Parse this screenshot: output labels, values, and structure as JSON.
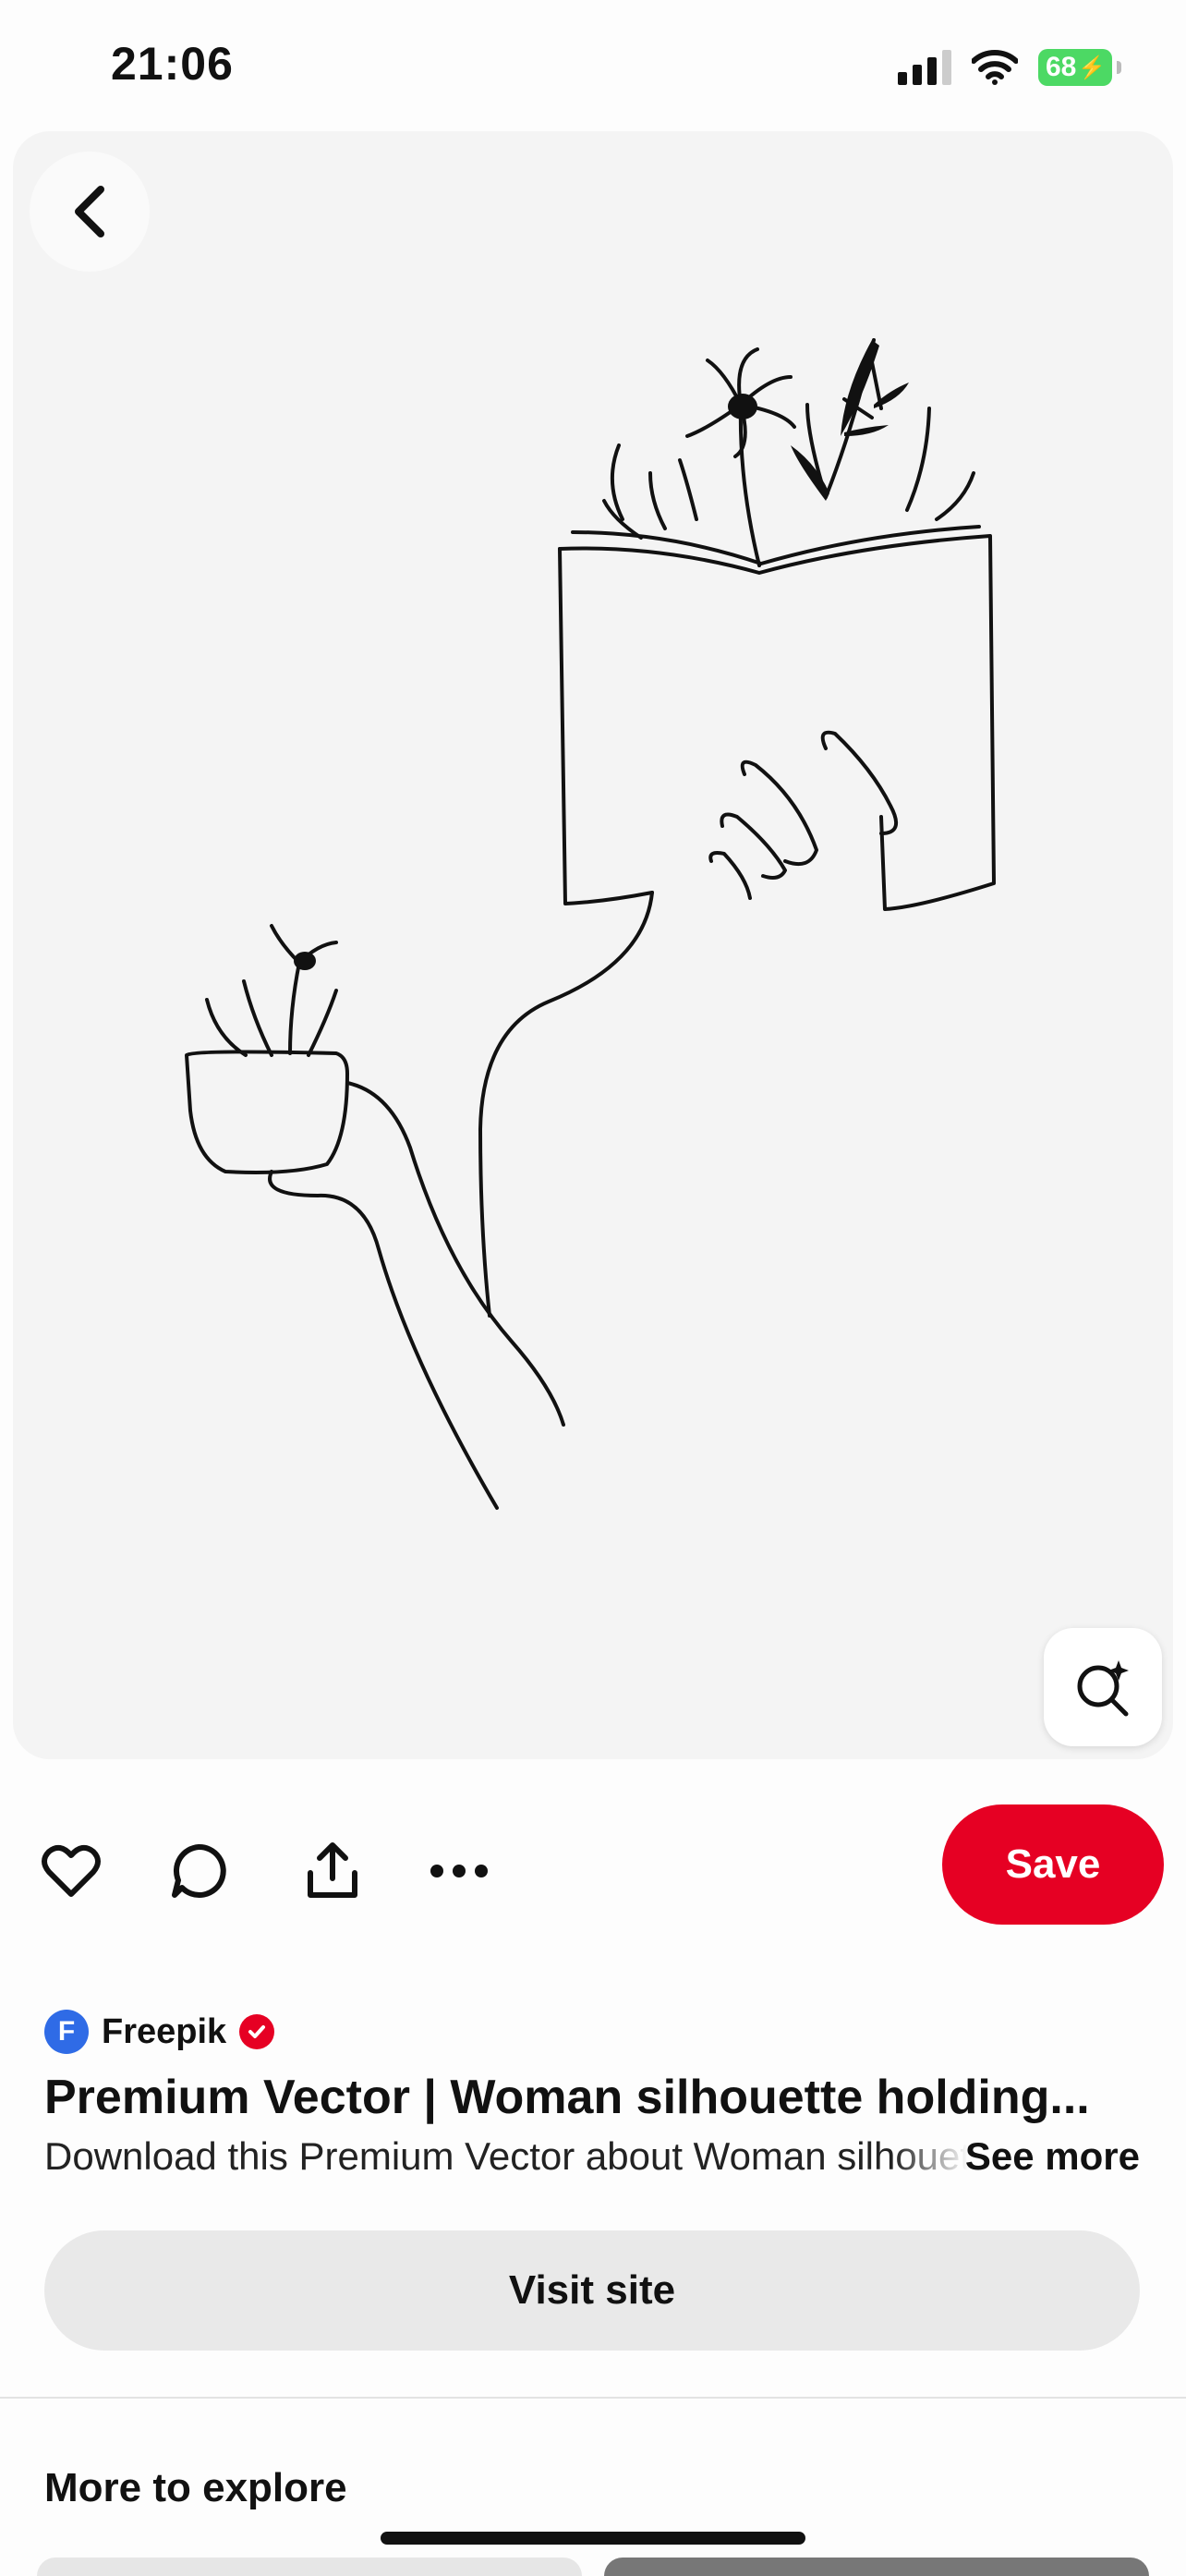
{
  "status_bar": {
    "time": "21:06",
    "battery": "68",
    "icons": [
      "signal-icon",
      "wifi-icon",
      "battery-charging-icon"
    ]
  },
  "pin": {
    "image_description_icons": [
      "back-icon",
      "visual-search-icon"
    ]
  },
  "actions": {
    "icons": [
      "heart-icon",
      "comment-icon",
      "share-icon",
      "more-icon"
    ],
    "save_label": "Save"
  },
  "source": {
    "name": "Freepik",
    "logo_letter": "F",
    "verified": true
  },
  "title": "Premium Vector | Woman silhouette holding...",
  "description": "Download this Premium Vector about Woman silhouette holding",
  "see_more": "See more",
  "visit_site": "Visit site",
  "more_to_explore": "More to explore",
  "colors": {
    "save": "#e60023",
    "source_logo": "#2f6be6",
    "battery": "#4cd964"
  }
}
